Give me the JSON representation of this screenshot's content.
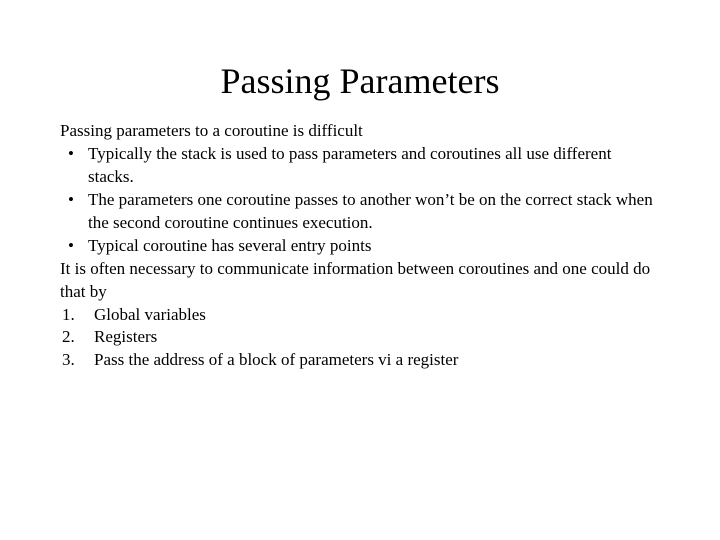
{
  "title": "Passing Parameters",
  "intro": "Passing parameters to a coroutine is difficult",
  "bullets": [
    "Typically the stack is used to pass parameters and coroutines all use different stacks.",
    "The parameters one coroutine passes to another won’t be on the correct stack when the second coroutine continues execution.",
    "Typical coroutine has several entry points"
  ],
  "intro2": "It is often necessary to communicate information between coroutines and one could do that by",
  "methods": [
    "Global variables",
    "Registers",
    "Pass the address of a block of parameters vi a register"
  ]
}
